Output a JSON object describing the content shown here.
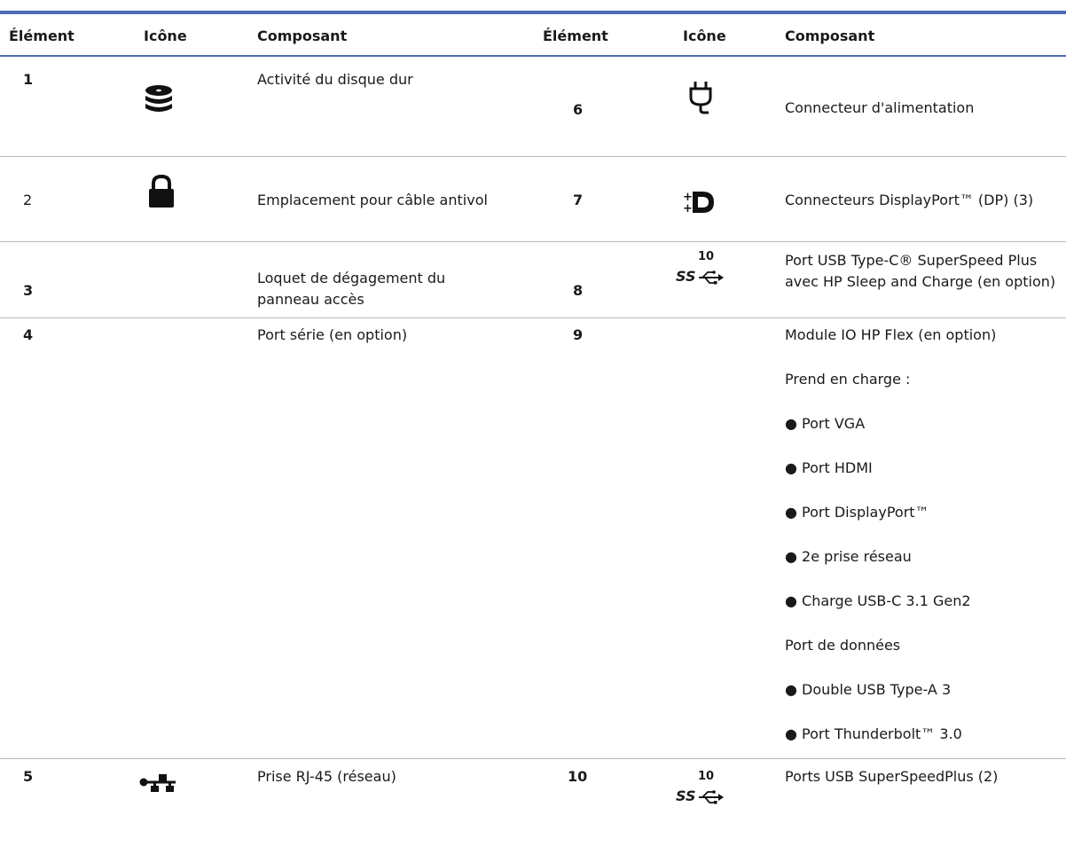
{
  "headers": {
    "element1": "Élément",
    "icon1": "Icône",
    "component1": "Composant",
    "element2": "Élément",
    "icon2": "Icône",
    "component2": "Composant"
  },
  "rows": [
    {
      "num": "1",
      "icon": "hard-drive-icon",
      "component": "Activité du disque dur",
      "num_right": "6",
      "icon_right": "power-plug-icon",
      "component_right": "Connecteur d'alimentation"
    },
    {
      "num": "2",
      "icon": "lock-icon",
      "component": "Emplacement pour câble antivol",
      "num_right": "7",
      "icon_right": "displayport-icon",
      "component_right": "Connecteurs DisplayPort™ (DP) (3)"
    },
    {
      "num": "3",
      "icon": "",
      "component": "Loquet de dégagement du panneau accès",
      "num_right": "8",
      "icon_right": "usb-superspeed-10-icon",
      "component_right": "Port USB Type-C® SuperSpeed Plus avec HP Sleep and Charge (en option)"
    },
    {
      "num": "4",
      "icon": "",
      "component": "Port série (en option)",
      "num_right": "9",
      "icon_right": "",
      "component_right": "Module IO HP Flex (en option)"
    },
    {
      "num": "5",
      "icon": "network-icon",
      "component": "Prise RJ-45 (réseau)",
      "num_right": "10",
      "icon_right": "usb-superspeed-10-icon",
      "component_right": "Ports USB SuperSpeedPlus (2)"
    }
  ],
  "module_details": [
    "Prend en charge :",
    "● Port VGA",
    "● Port HDMI",
    "● Port DisplayPort™",
    "● 2e prise réseau",
    "● Charge USB-C 3.1 Gen2",
    "Port de données",
    "● Double USB Type-A 3",
    "● Port Thunderbolt™ 3.0"
  ],
  "usb_speed_label": "10",
  "usb_ss_label": "SS",
  "colors": {
    "accent": "#4d6cb5",
    "rule": "#b8b8b8",
    "text": "#1a1a1a"
  }
}
